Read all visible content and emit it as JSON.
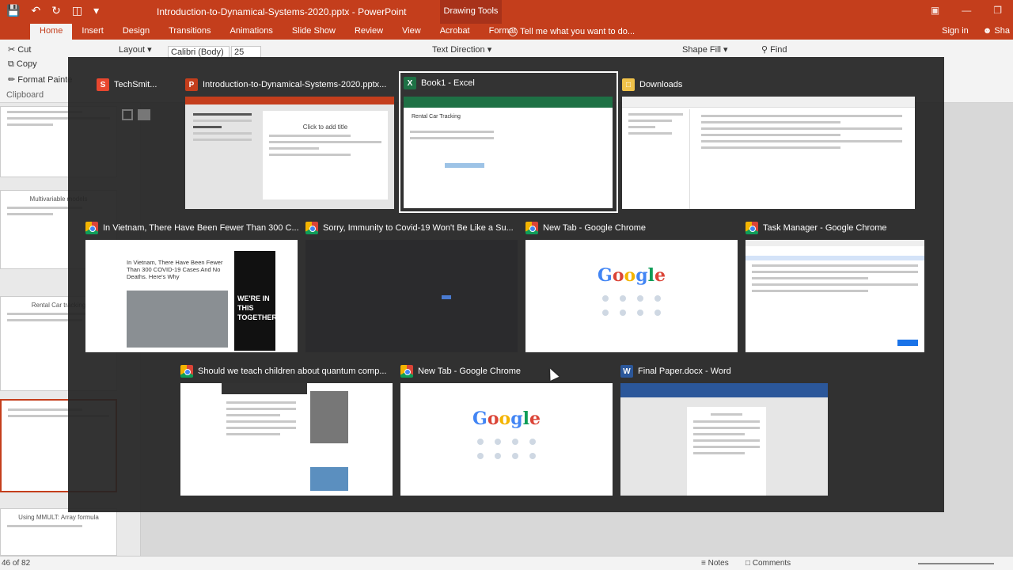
{
  "app": {
    "document_title": "Introduction-to-Dynamical-Systems-2020.pptx - PowerPoint",
    "contextual_tab_group": "Drawing Tools",
    "tabs": [
      "Home",
      "Insert",
      "Design",
      "Transitions",
      "Animations",
      "Slide Show",
      "Review",
      "View",
      "Acrobat",
      "Format"
    ],
    "active_tab": "Home",
    "tell_me": "Tell me what you want to do...",
    "sign_in": "Sign in",
    "share": "Sha"
  },
  "ribbon": {
    "cut": "Cut",
    "copy": "Copy",
    "format_painter": "Format Painte",
    "clipboard": "Clipboard",
    "layout": "Layout",
    "font_name": "Calibri (Body)",
    "font_size": "25",
    "text_direction": "Text Direction",
    "shape_fill": "Shape Fill",
    "find": "Find"
  },
  "thumbnails": {
    "t1": "Multivariable models",
    "t2": "Rental Car tracking",
    "t3": "Using MMULT: Array formula"
  },
  "status": {
    "slide_count": "46 of 82",
    "notes": "Notes",
    "comments": "Comments"
  },
  "switcher": {
    "windows": [
      {
        "title": "TechSmit...",
        "icon": "techsmith-icon"
      },
      {
        "title": "Introduction-to-Dynamical-Systems-2020.pptx...",
        "icon": "powerpoint-icon",
        "preview_text": "Click to add title"
      },
      {
        "title": "Book1 - Excel",
        "icon": "excel-icon",
        "preview_text": "Rental Car Tracking"
      },
      {
        "title": "Downloads",
        "icon": "folder-icon"
      },
      {
        "title": "In Vietnam, There Have Been Fewer Than 300 C...",
        "icon": "chrome-icon",
        "preview_text": "In Vietnam, There Have Been Fewer Than 300 COVID-19 Cases And No Deaths. Here's Why",
        "ad_text": "WE'RE IN THIS TOGETHER."
      },
      {
        "title": "Sorry, Immunity to Covid-19 Won't Be Like a Su...",
        "icon": "chrome-icon"
      },
      {
        "title": "New Tab - Google Chrome",
        "icon": "chrome-icon"
      },
      {
        "title": "Task Manager - Google Chrome",
        "icon": "chrome-icon"
      },
      {
        "title": "Should we teach children about quantum comp...",
        "icon": "chrome-icon"
      },
      {
        "title": "New Tab - Google Chrome",
        "icon": "chrome-icon"
      },
      {
        "title": "Final Paper.docx - Word",
        "icon": "word-icon"
      }
    ]
  }
}
